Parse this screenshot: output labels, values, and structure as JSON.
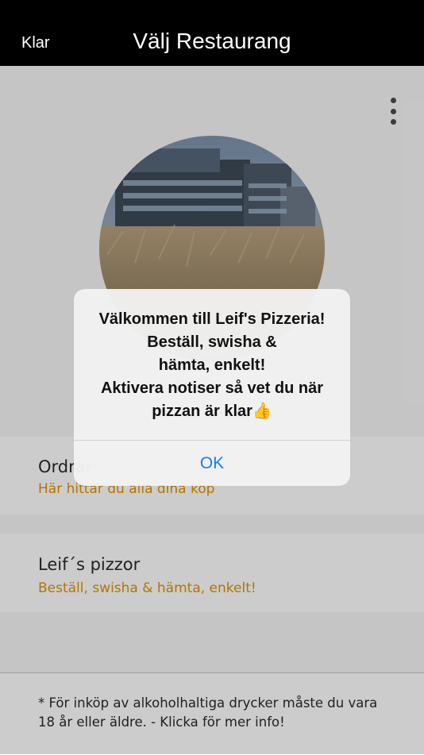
{
  "navbar": {
    "back_label": "Klar",
    "title": "Välj Restaurang"
  },
  "menu": {
    "icon": "more-vertical-icon"
  },
  "hero": {
    "icon": "restaurant-photo"
  },
  "rows": [
    {
      "title": "Ordrar",
      "subtitle": "Här hittar du alla dina köp"
    },
    {
      "title": "Leif´s pizzor",
      "subtitle": "Beställ, swisha & hämta, enkelt!"
    }
  ],
  "footer": {
    "text": "* För inköp av alkoholhaltiga drycker måste du vara 18 år eller äldre. - Klicka för mer info!"
  },
  "alert": {
    "lines": [
      "Välkommen till Leif's Pizzeria!",
      "Beställ, swisha &",
      "hämta, enkelt!",
      "Aktivera notiser så vet du när",
      "pizzan är klar👍"
    ],
    "ok_label": "OK"
  },
  "colors": {
    "accent_orange": "#e29200",
    "ios_blue": "#1a7cf5",
    "navbar_bg": "#000000"
  }
}
